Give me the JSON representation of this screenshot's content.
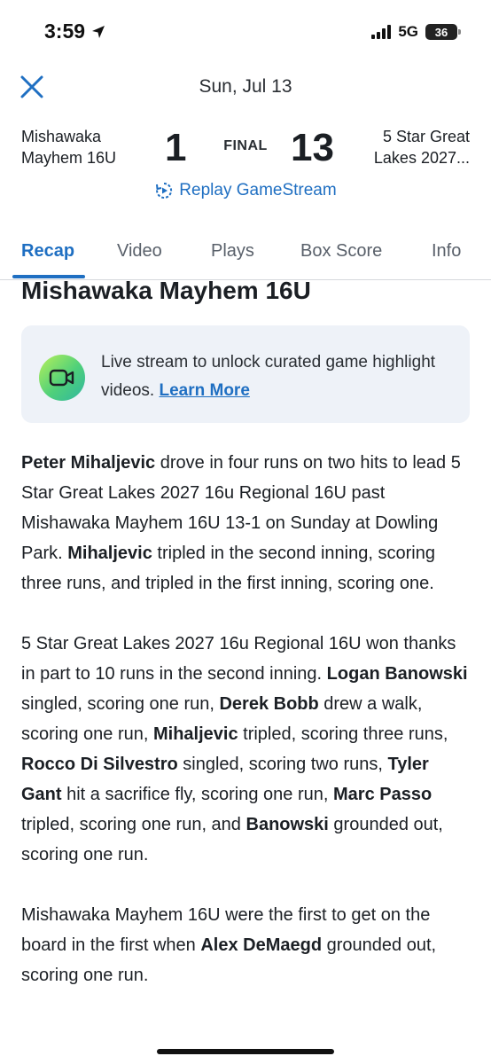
{
  "status": {
    "time": "3:59",
    "network": "5G",
    "battery": "36"
  },
  "header": {
    "date": "Sun, Jul 13"
  },
  "game": {
    "home_team_line1": "Mishawaka",
    "home_team_line2": "Mayhem 16U",
    "home_score": "1",
    "status": "FINAL",
    "away_score": "13",
    "away_team_line1": "5 Star Great",
    "away_team_line2": "Lakes 2027..."
  },
  "replay": {
    "label": "Replay GameStream"
  },
  "tabs": [
    {
      "label": "Recap"
    },
    {
      "label": "Video"
    },
    {
      "label": "Plays"
    },
    {
      "label": "Box Score"
    },
    {
      "label": "Info"
    }
  ],
  "section": {
    "title": "Mishawaka Mayhem 16U"
  },
  "promo": {
    "text": "Live stream to unlock curated game highlight videos.",
    "link": "Learn More"
  },
  "article": {
    "p1": [
      {
        "t": "Peter Mihaljevic",
        "b": true
      },
      {
        "t": " drove in four runs on two hits to lead 5 Star Great Lakes 2027 16u Regional 16U past Mishawaka Mayhem 16U 13-1 on Sunday at Dowling Park. ",
        "b": false
      },
      {
        "t": "Mihaljevic",
        "b": true
      },
      {
        "t": " tripled in the second inning, scoring three runs, and tripled in the first inning, scoring one.",
        "b": false
      }
    ],
    "p2": [
      {
        "t": "5 Star Great Lakes 2027 16u Regional 16U won thanks in part to 10 runs in the second inning. ",
        "b": false
      },
      {
        "t": "Logan Banowski",
        "b": true
      },
      {
        "t": " singled, scoring one run, ",
        "b": false
      },
      {
        "t": "Derek Bobb",
        "b": true
      },
      {
        "t": " drew a walk, scoring one run, ",
        "b": false
      },
      {
        "t": "Mihaljevic",
        "b": true
      },
      {
        "t": " tripled, scoring three runs, ",
        "b": false
      },
      {
        "t": "Rocco Di Silvestro",
        "b": true
      },
      {
        "t": " singled, scoring two runs, ",
        "b": false
      },
      {
        "t": "Tyler Gant",
        "b": true
      },
      {
        "t": " hit a sacrifice fly, scoring one run, ",
        "b": false
      },
      {
        "t": "Marc Passo",
        "b": true
      },
      {
        "t": " tripled, scoring one run, and ",
        "b": false
      },
      {
        "t": "Banowski",
        "b": true
      },
      {
        "t": " grounded out, scoring one run.",
        "b": false
      }
    ],
    "p3": [
      {
        "t": "Mishawaka Mayhem 16U were the first to get on the board in the first when ",
        "b": false
      },
      {
        "t": "Alex DeMaegd",
        "b": true
      },
      {
        "t": " grounded out, scoring one run.",
        "b": false
      }
    ]
  },
  "colors": {
    "accent": "#1f6fc2",
    "promo_bg": "#eef2f8",
    "text": "#1b1f24"
  },
  "icons": {
    "close": "close-icon",
    "replay": "replay-icon",
    "camera": "video-camera-icon",
    "location": "location-arrow-icon"
  }
}
